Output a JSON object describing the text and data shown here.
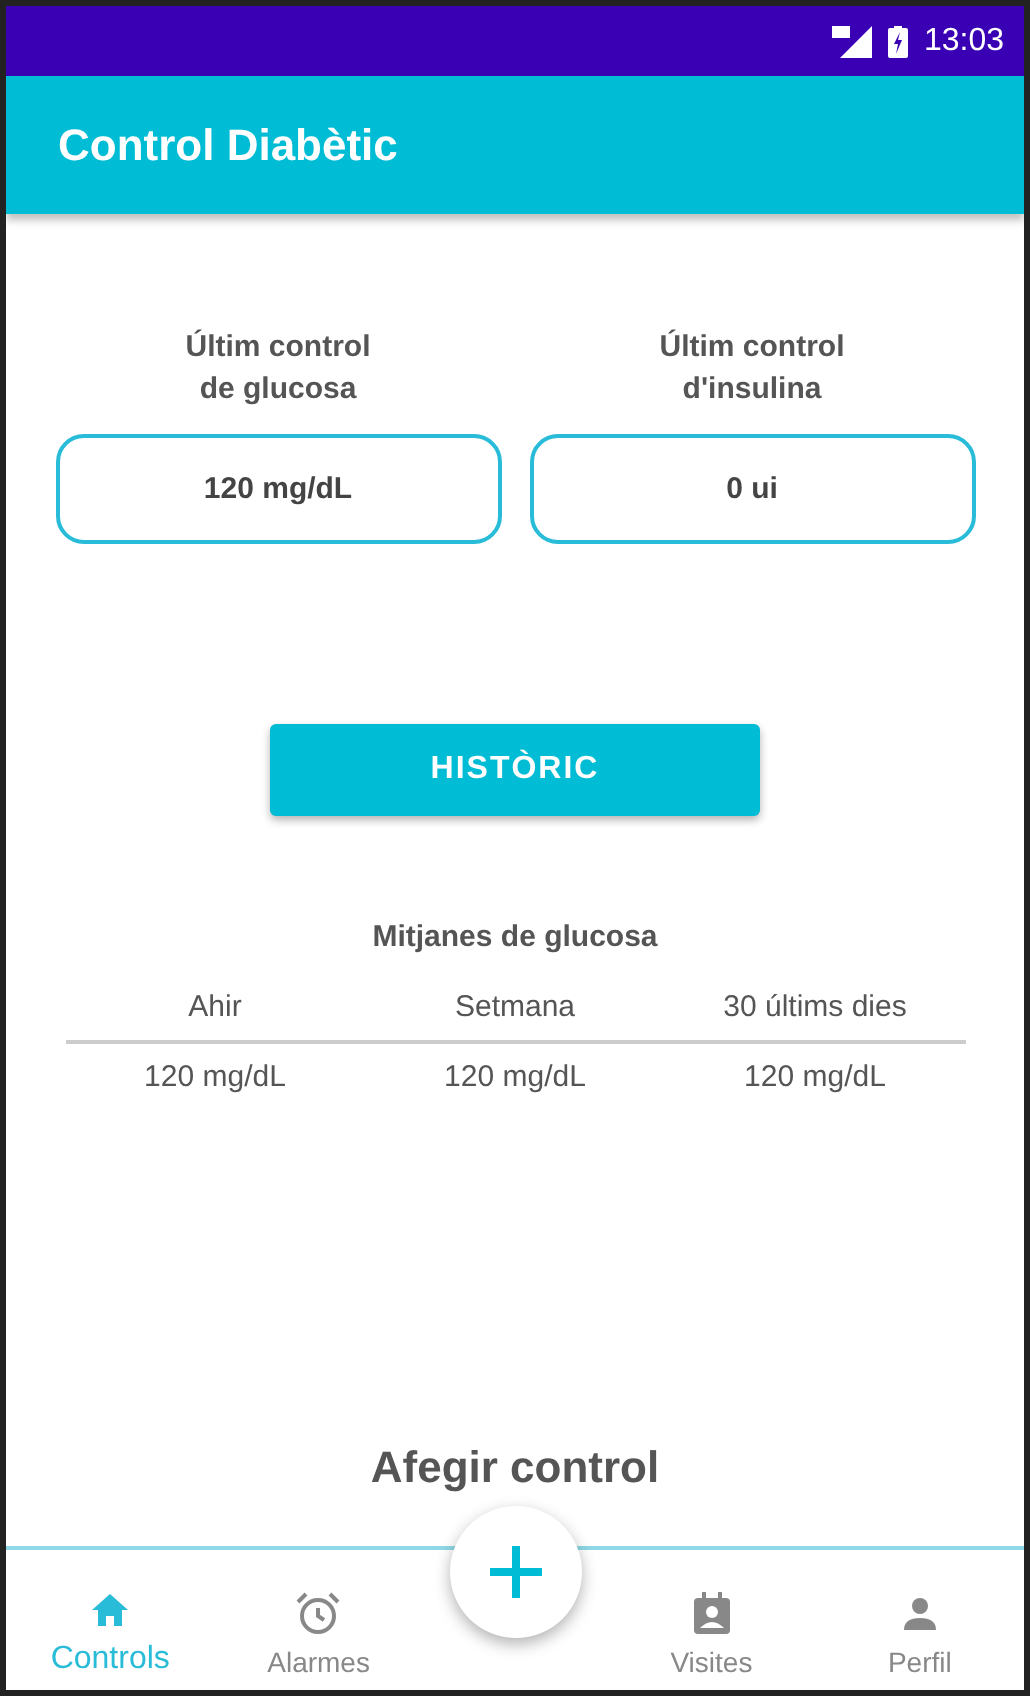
{
  "status_bar": {
    "time": "13:03"
  },
  "app_bar": {
    "title": "Control Diabètic"
  },
  "last_controls": [
    {
      "label": "Últim control\nde glucosa",
      "value": "120 mg/dL"
    },
    {
      "label": "Últim control\nd'insulina",
      "value": "0 ui"
    }
  ],
  "history_button": "HISTÒRIC",
  "averages": {
    "title": "Mitjanes de glucosa",
    "columns": [
      "Ahir",
      "Setmana",
      "30 últims dies"
    ],
    "values": [
      "120 mg/dL",
      "120 mg/dL",
      "120 mg/dL"
    ]
  },
  "add_control": {
    "title": "Afegir control"
  },
  "bottom_nav": [
    {
      "kind": "home",
      "label": "Controls",
      "selected": true
    },
    {
      "kind": "alarm",
      "label": "Alarmes",
      "selected": false
    },
    {
      "kind": "fab"
    },
    {
      "kind": "visits",
      "label": "Visites",
      "selected": false
    },
    {
      "kind": "profile",
      "label": "Perfil",
      "selected": false
    }
  ]
}
